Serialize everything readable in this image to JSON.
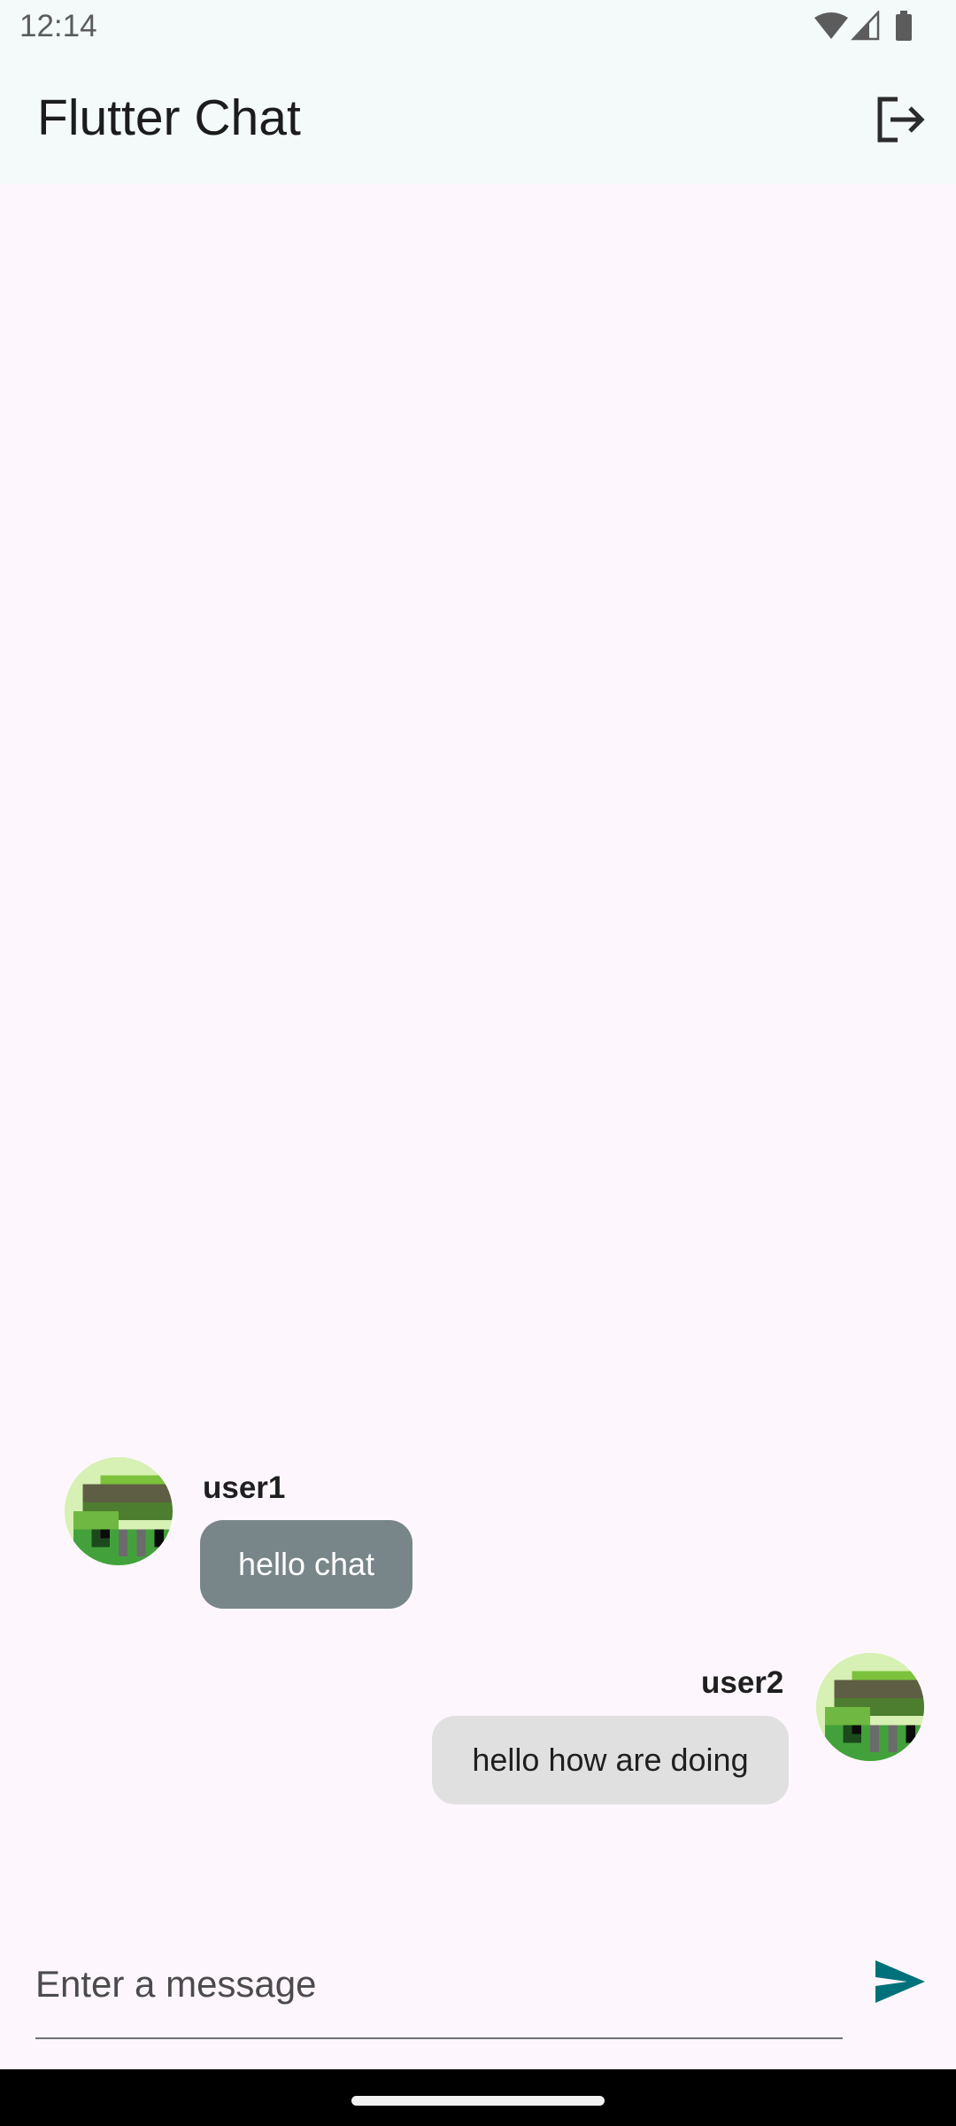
{
  "status_bar": {
    "time": "12:14",
    "icons": [
      "wifi-icon",
      "signal-icon",
      "battery-icon"
    ]
  },
  "app_bar": {
    "title": "Flutter Chat",
    "logout_icon": "logout-icon"
  },
  "messages": [
    {
      "username": "user1",
      "text": "hello chat",
      "avatar": "pixel-avatar",
      "side": "left"
    },
    {
      "username": "user2",
      "text": "hello how are doing",
      "avatar": "pixel-avatar",
      "side": "right"
    }
  ],
  "composer": {
    "placeholder": "Enter a message",
    "value": "",
    "send_icon": "send-icon",
    "accent": "#00707A"
  },
  "colors": {
    "background": "#FDF7FD",
    "app_bar": "#F4FAFA",
    "bubble_user1": "#78868A",
    "bubble_user2": "#E0E0E0"
  }
}
